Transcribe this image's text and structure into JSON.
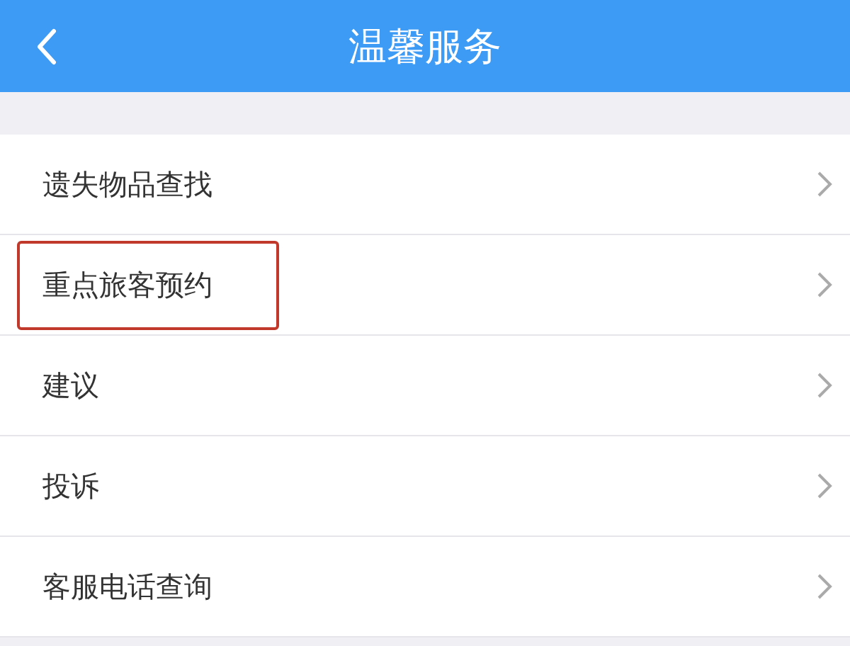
{
  "header": {
    "title": "温馨服务"
  },
  "items": [
    {
      "label": "遗失物品查找",
      "highlighted": false
    },
    {
      "label": "重点旅客预约",
      "highlighted": true
    },
    {
      "label": "建议",
      "highlighted": false
    },
    {
      "label": "投诉",
      "highlighted": false
    },
    {
      "label": "客服电话查询",
      "highlighted": false
    }
  ]
}
